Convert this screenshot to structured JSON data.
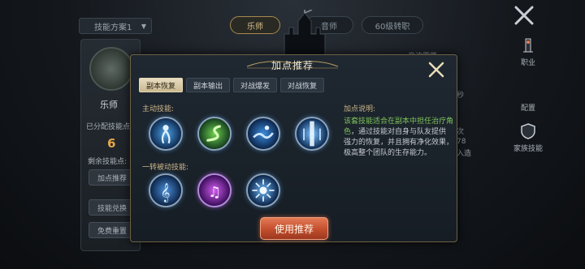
{
  "background": {
    "plan_dropdown": "技能方案1",
    "class_tabs": [
      "乐师",
      "音师",
      "60级转职"
    ],
    "class_name": "乐师",
    "assigned_label": "已分配技能点",
    "points_value": "6",
    "remaining_label": "剩余技能点:",
    "buttons": [
      "加点推荐",
      "技能兑换",
      "免费重置"
    ],
    "right_texts": [
      "音波震荡",
      "秒",
      "次",
      "78",
      "入造"
    ]
  },
  "side_menu": [
    {
      "label": "职业",
      "icon": "sword-tower-icon"
    },
    {
      "label": "配置",
      "icon": "crescent-icon"
    },
    {
      "label": "家族技能",
      "icon": "shield-icon"
    }
  ],
  "modal": {
    "title": "加点推荐",
    "tabs": [
      {
        "label": "副本恢复",
        "active": true
      },
      {
        "label": "副本输出",
        "active": false
      },
      {
        "label": "对战爆发",
        "active": false
      },
      {
        "label": "对战恢复",
        "active": false
      }
    ],
    "active_label": "主动技能:",
    "passive_label": "一转被动技能:",
    "active_skills": [
      "figure-skill-icon",
      "serpent-skill-icon",
      "wave-skill-icon",
      "light-beam-skill-icon"
    ],
    "passive_skills": [
      "clef-skill-icon",
      "music-note-skill-icon",
      "burst-skill-icon"
    ],
    "info_title": "加点说明:",
    "info_highlight": "该套技能适合在副本中担任治疗角色",
    "info_body": "，通过技能对自身与队友提供强力的恢复，并且拥有净化效果，极高整个团队的生存能力。",
    "use_button": "使用推荐"
  }
}
